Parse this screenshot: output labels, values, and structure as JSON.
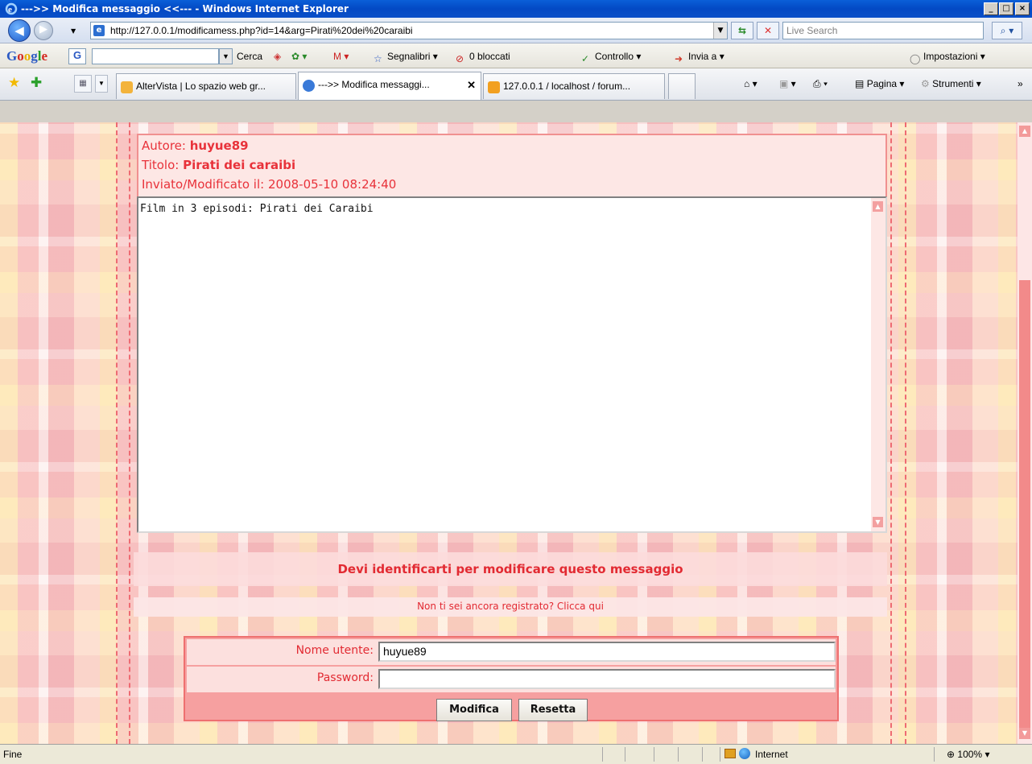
{
  "window": {
    "title": "--->> Modifica messaggio <<--- - Windows Internet Explorer",
    "min": "_",
    "max": "□",
    "close": "×"
  },
  "address": {
    "url": "http://127.0.0.1/modificamess.php?id=14&arg=Pirati%20dei%20caraibi",
    "search_placeholder": "Live Search"
  },
  "google_toolbar": {
    "search_label": "Cerca",
    "bookmarks": "Segnalibri",
    "blocked": "0 bloccati",
    "spellcheck": "Controllo",
    "send": "Invia a",
    "settings": "Impostazioni"
  },
  "tabs": [
    {
      "label": "AlterVista | Lo spazio web gr...",
      "active": false
    },
    {
      "label": "--->> Modifica messaggi...",
      "active": true
    },
    {
      "label": "127.0.0.1 / localhost / forum...",
      "active": false
    }
  ],
  "command_bar": {
    "page": "Pagina",
    "tools": "Strumenti"
  },
  "message": {
    "author_label": "Autore:",
    "author": "huyue89",
    "title_label": "Titolo:",
    "title": "Pirati dei caraibi",
    "date_label": "Inviato/Modificato il:",
    "date": "2008-05-10 08:24:40",
    "body": "Film in 3 episodi: Pirati dei Caraibi"
  },
  "auth": {
    "notice": "Devi identificarti per modificare questo messaggio",
    "register_link": "Non ti sei ancora registrato? Clicca qui",
    "username_label": "Nome utente:",
    "username_value": "huyue89",
    "password_label": "Password:",
    "password_value": "",
    "submit": "Modifica",
    "reset": "Resetta"
  },
  "status": {
    "text": "Fine",
    "zone": "Internet",
    "zoom": "100%"
  },
  "colors": {
    "accent": "#e22a32",
    "panel_border": "#f09090"
  }
}
